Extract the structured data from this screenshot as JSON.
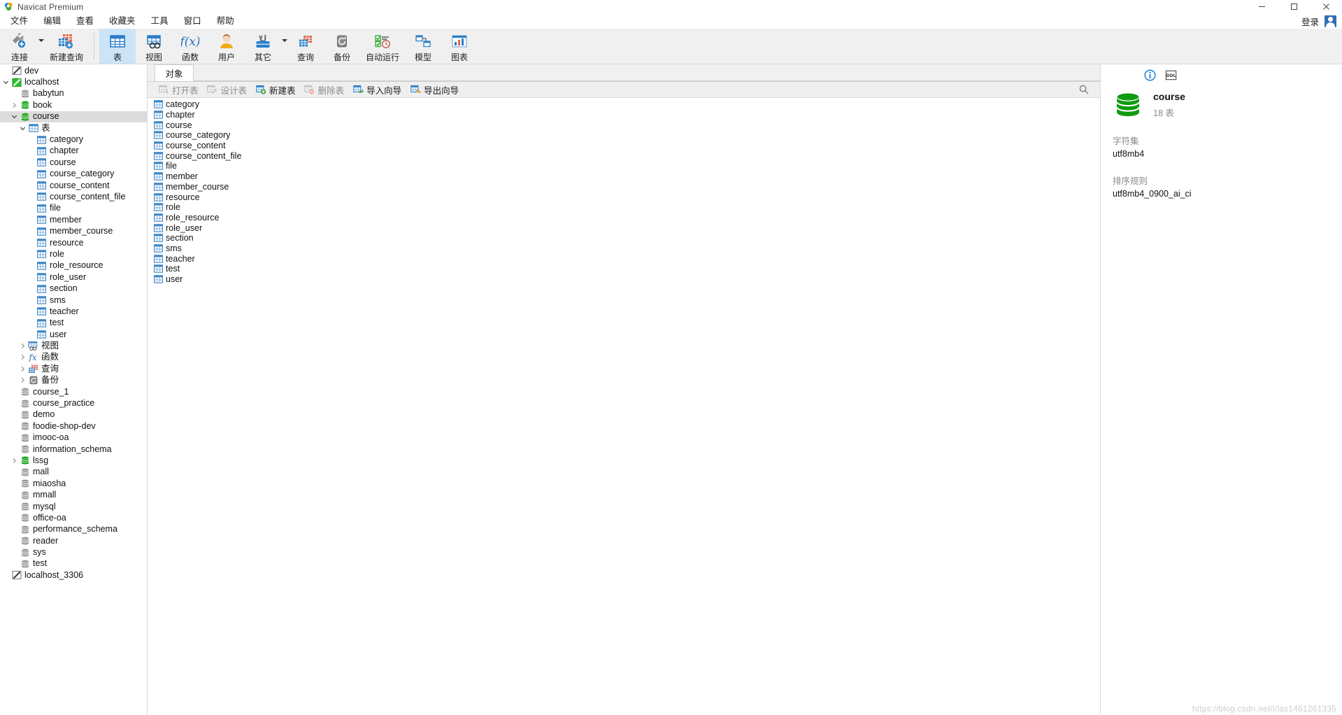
{
  "window": {
    "title": "Navicat Premium",
    "minimize_label": "minimize",
    "maximize_label": "maximize",
    "close_label": "close"
  },
  "menubar": {
    "items": [
      {
        "label": "文件"
      },
      {
        "label": "编辑"
      },
      {
        "label": "查看"
      },
      {
        "label": "收藏夹"
      },
      {
        "label": "工具"
      },
      {
        "label": "窗口"
      },
      {
        "label": "帮助"
      }
    ],
    "login_label": "登录"
  },
  "toolbar": {
    "groups": [
      {
        "buttons": [
          {
            "label": "连接",
            "icon": "connection-icon",
            "caret": true,
            "active": false
          },
          {
            "label": "新建查询",
            "icon": "new-query-icon",
            "caret": false,
            "active": false
          }
        ]
      },
      {
        "buttons": [
          {
            "label": "表",
            "icon": "table-icon",
            "caret": false,
            "active": true
          },
          {
            "label": "视图",
            "icon": "view-icon",
            "caret": false,
            "active": false
          },
          {
            "label": "函数",
            "icon": "function-icon",
            "caret": false,
            "active": false
          },
          {
            "label": "用户",
            "icon": "user-icon",
            "caret": false,
            "active": false
          },
          {
            "label": "其它",
            "icon": "others-toolbox-icon",
            "caret": true,
            "active": false
          },
          {
            "label": "查询",
            "icon": "query-icon",
            "caret": false,
            "active": false
          },
          {
            "label": "备份",
            "icon": "backup-icon",
            "caret": false,
            "active": false
          },
          {
            "label": "自动运行",
            "icon": "automation-icon",
            "caret": false,
            "active": false
          },
          {
            "label": "模型",
            "icon": "model-icon",
            "caret": false,
            "active": false
          },
          {
            "label": "图表",
            "icon": "chart-icon",
            "caret": false,
            "active": false
          }
        ]
      }
    ]
  },
  "sidebar": {
    "rows": [
      {
        "label": "dev",
        "indent": 0,
        "twisty": "none",
        "icon": "connection-gray-icon",
        "selected": false
      },
      {
        "label": "localhost",
        "indent": 0,
        "twisty": "open",
        "icon": "connection-green-icon",
        "selected": false
      },
      {
        "label": "babytun",
        "indent": 1,
        "twisty": "none",
        "icon": "database-gray-icon",
        "selected": false
      },
      {
        "label": "book",
        "indent": 1,
        "twisty": "closed",
        "icon": "database-green-icon",
        "selected": false
      },
      {
        "label": "course",
        "indent": 1,
        "twisty": "open",
        "icon": "database-green-icon",
        "selected": true
      },
      {
        "label": "表",
        "indent": 2,
        "twisty": "open",
        "icon": "table-folder-icon",
        "selected": false
      },
      {
        "label": "category",
        "indent": 3,
        "twisty": "none",
        "icon": "table-icon",
        "selected": false
      },
      {
        "label": "chapter",
        "indent": 3,
        "twisty": "none",
        "icon": "table-icon",
        "selected": false
      },
      {
        "label": "course",
        "indent": 3,
        "twisty": "none",
        "icon": "table-icon",
        "selected": false
      },
      {
        "label": "course_category",
        "indent": 3,
        "twisty": "none",
        "icon": "table-icon",
        "selected": false
      },
      {
        "label": "course_content",
        "indent": 3,
        "twisty": "none",
        "icon": "table-icon",
        "selected": false
      },
      {
        "label": "course_content_file",
        "indent": 3,
        "twisty": "none",
        "icon": "table-icon",
        "selected": false
      },
      {
        "label": "file",
        "indent": 3,
        "twisty": "none",
        "icon": "table-icon",
        "selected": false
      },
      {
        "label": "member",
        "indent": 3,
        "twisty": "none",
        "icon": "table-icon",
        "selected": false
      },
      {
        "label": "member_course",
        "indent": 3,
        "twisty": "none",
        "icon": "table-icon",
        "selected": false
      },
      {
        "label": "resource",
        "indent": 3,
        "twisty": "none",
        "icon": "table-icon",
        "selected": false
      },
      {
        "label": "role",
        "indent": 3,
        "twisty": "none",
        "icon": "table-icon",
        "selected": false
      },
      {
        "label": "role_resource",
        "indent": 3,
        "twisty": "none",
        "icon": "table-icon",
        "selected": false
      },
      {
        "label": "role_user",
        "indent": 3,
        "twisty": "none",
        "icon": "table-icon",
        "selected": false
      },
      {
        "label": "section",
        "indent": 3,
        "twisty": "none",
        "icon": "table-icon",
        "selected": false
      },
      {
        "label": "sms",
        "indent": 3,
        "twisty": "none",
        "icon": "table-icon",
        "selected": false
      },
      {
        "label": "teacher",
        "indent": 3,
        "twisty": "none",
        "icon": "table-icon",
        "selected": false
      },
      {
        "label": "test",
        "indent": 3,
        "twisty": "none",
        "icon": "table-icon",
        "selected": false
      },
      {
        "label": "user",
        "indent": 3,
        "twisty": "none",
        "icon": "table-icon",
        "selected": false
      },
      {
        "label": "视图",
        "indent": 2,
        "twisty": "closed",
        "icon": "view-folder-icon",
        "selected": false
      },
      {
        "label": "函数",
        "indent": 2,
        "twisty": "closed",
        "icon": "function-folder-icon",
        "selected": false
      },
      {
        "label": "查询",
        "indent": 2,
        "twisty": "closed",
        "icon": "query-folder-icon",
        "selected": false
      },
      {
        "label": "备份",
        "indent": 2,
        "twisty": "closed",
        "icon": "backup-folder-icon",
        "selected": false
      },
      {
        "label": "course_1",
        "indent": 1,
        "twisty": "none",
        "icon": "database-gray-icon",
        "selected": false
      },
      {
        "label": "course_practice",
        "indent": 1,
        "twisty": "none",
        "icon": "database-gray-icon",
        "selected": false
      },
      {
        "label": "demo",
        "indent": 1,
        "twisty": "none",
        "icon": "database-gray-icon",
        "selected": false
      },
      {
        "label": "foodie-shop-dev",
        "indent": 1,
        "twisty": "none",
        "icon": "database-gray-icon",
        "selected": false
      },
      {
        "label": "imooc-oa",
        "indent": 1,
        "twisty": "none",
        "icon": "database-gray-icon",
        "selected": false
      },
      {
        "label": "information_schema",
        "indent": 1,
        "twisty": "none",
        "icon": "database-gray-icon",
        "selected": false
      },
      {
        "label": "lssg",
        "indent": 1,
        "twisty": "closed",
        "icon": "database-green-icon",
        "selected": false
      },
      {
        "label": "mall",
        "indent": 1,
        "twisty": "none",
        "icon": "database-gray-icon",
        "selected": false
      },
      {
        "label": "miaosha",
        "indent": 1,
        "twisty": "none",
        "icon": "database-gray-icon",
        "selected": false
      },
      {
        "label": "mmall",
        "indent": 1,
        "twisty": "none",
        "icon": "database-gray-icon",
        "selected": false
      },
      {
        "label": "mysql",
        "indent": 1,
        "twisty": "none",
        "icon": "database-gray-icon",
        "selected": false
      },
      {
        "label": "office-oa",
        "indent": 1,
        "twisty": "none",
        "icon": "database-gray-icon",
        "selected": false
      },
      {
        "label": "performance_schema",
        "indent": 1,
        "twisty": "none",
        "icon": "database-gray-icon",
        "selected": false
      },
      {
        "label": "reader",
        "indent": 1,
        "twisty": "none",
        "icon": "database-gray-icon",
        "selected": false
      },
      {
        "label": "sys",
        "indent": 1,
        "twisty": "none",
        "icon": "database-gray-icon",
        "selected": false
      },
      {
        "label": "test",
        "indent": 1,
        "twisty": "none",
        "icon": "database-gray-icon",
        "selected": false
      },
      {
        "label": "localhost_3306",
        "indent": 0,
        "twisty": "none",
        "icon": "connection-gray-icon",
        "selected": false
      }
    ]
  },
  "main": {
    "tabs": [
      {
        "label": "对象",
        "active": true
      }
    ],
    "actions": [
      {
        "label": "打开表",
        "icon": "open-table-icon",
        "disabled": true
      },
      {
        "label": "设计表",
        "icon": "design-table-icon",
        "disabled": true
      },
      {
        "label": "新建表",
        "icon": "new-table-icon",
        "disabled": false
      },
      {
        "label": "删除表",
        "icon": "delete-table-icon",
        "disabled": true
      },
      {
        "label": "导入向导",
        "icon": "import-wizard-icon",
        "disabled": false
      },
      {
        "label": "导出向导",
        "icon": "export-wizard-icon",
        "disabled": false
      }
    ],
    "search_icon": "search-icon",
    "objects": [
      {
        "label": "category",
        "icon": "table-icon"
      },
      {
        "label": "chapter",
        "icon": "table-icon"
      },
      {
        "label": "course",
        "icon": "table-icon"
      },
      {
        "label": "course_category",
        "icon": "table-icon"
      },
      {
        "label": "course_content",
        "icon": "table-icon"
      },
      {
        "label": "course_content_file",
        "icon": "table-icon"
      },
      {
        "label": "file",
        "icon": "table-icon"
      },
      {
        "label": "member",
        "icon": "table-icon"
      },
      {
        "label": "member_course",
        "icon": "table-icon"
      },
      {
        "label": "resource",
        "icon": "table-icon"
      },
      {
        "label": "role",
        "icon": "table-icon"
      },
      {
        "label": "role_resource",
        "icon": "table-icon"
      },
      {
        "label": "role_user",
        "icon": "table-icon"
      },
      {
        "label": "section",
        "icon": "table-icon"
      },
      {
        "label": "sms",
        "icon": "table-icon"
      },
      {
        "label": "teacher",
        "icon": "table-icon"
      },
      {
        "label": "test",
        "icon": "table-icon"
      },
      {
        "label": "user",
        "icon": "table-icon"
      }
    ]
  },
  "info_panel": {
    "info_icon": "info-circle-icon",
    "ddl_icon": "ddl-icon",
    "db_icon": "database-green-icon",
    "name": "course",
    "table_count": "18 表",
    "fields": [
      {
        "key": "字符集",
        "value": "utf8mb4"
      },
      {
        "key": "排序规则",
        "value": "utf8mb4_0900_ai_ci"
      }
    ]
  },
  "watermark": "https://blog.csdn.net/l/las1461261335",
  "colors": {
    "accent_blue": "#2a7fc9",
    "active_tab_bg": "#cce4f7",
    "green_db": "#12a012",
    "selection_gray": "#dcdcdc"
  }
}
